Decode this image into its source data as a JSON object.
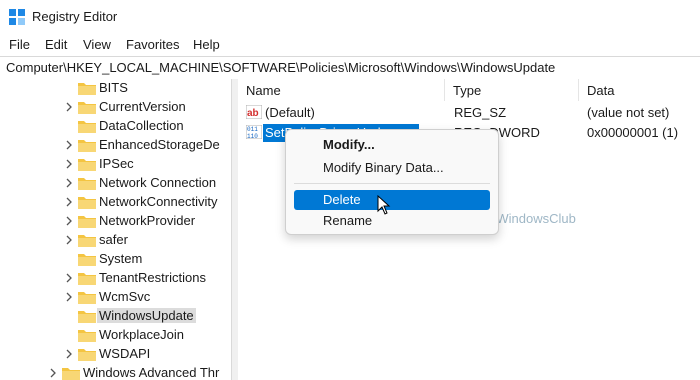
{
  "window": {
    "title": "Registry Editor"
  },
  "menu": [
    "File",
    "Edit",
    "View",
    "Favorites",
    "Help"
  ],
  "address": "Computer\\HKEY_LOCAL_MACHINE\\SOFTWARE\\Policies\\Microsoft\\Windows\\WindowsUpdate",
  "tree": [
    {
      "label": "BITS",
      "expandable": false
    },
    {
      "label": "CurrentVersion",
      "expandable": true
    },
    {
      "label": "DataCollection",
      "expandable": false
    },
    {
      "label": "EnhancedStorageDe",
      "expandable": true
    },
    {
      "label": "IPSec",
      "expandable": true
    },
    {
      "label": "Network Connection",
      "expandable": true
    },
    {
      "label": "NetworkConnectivity",
      "expandable": true
    },
    {
      "label": "NetworkProvider",
      "expandable": true
    },
    {
      "label": "safer",
      "expandable": true
    },
    {
      "label": "System",
      "expandable": false
    },
    {
      "label": "TenantRestrictions",
      "expandable": true
    },
    {
      "label": "WcmSvc",
      "expandable": true
    },
    {
      "label": "WindowsUpdate",
      "expandable": false,
      "selected": true
    },
    {
      "label": "WorkplaceJoin",
      "expandable": false
    },
    {
      "label": "WSDAPI",
      "expandable": true
    },
    {
      "label": "Windows Advanced Thr",
      "expandable": true
    }
  ],
  "columns": {
    "name": "Name",
    "type": "Type",
    "data": "Data"
  },
  "rows": [
    {
      "name": "(Default)",
      "type": "REG_SZ",
      "data": "(value not set)",
      "icon": "string-value-icon"
    },
    {
      "name": "SetPolicyDrivenUpd",
      "type": "REG_DWORD",
      "data": "0x00000001 (1)",
      "icon": "binary-value-icon"
    }
  ],
  "context_menu": {
    "modify": "Modify...",
    "modify_binary": "Modify Binary Data...",
    "delete": "Delete",
    "rename": "Rename"
  },
  "watermark": "TheWindowsClub",
  "colors": {
    "accent": "#0078d4",
    "folder": "#f4c542"
  }
}
